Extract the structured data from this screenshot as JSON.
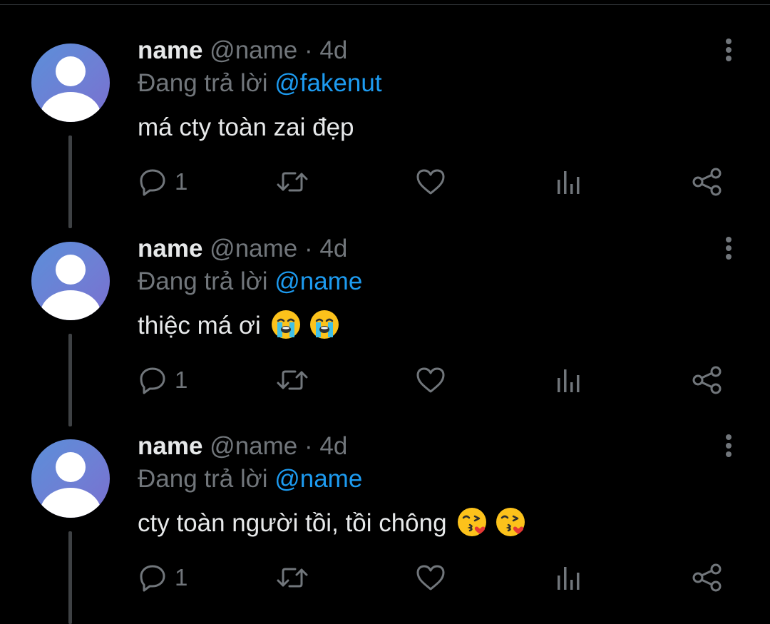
{
  "tweets": [
    {
      "name": "name",
      "handle": "@name",
      "separator": "·",
      "time": "4d",
      "reply_prefix": "Đang trả lời",
      "reply_to": "@fakenut",
      "text": "má cty toàn zai đẹp",
      "emojis": [],
      "reply_count": "1"
    },
    {
      "name": "name",
      "handle": "@name",
      "separator": "·",
      "time": "4d",
      "reply_prefix": "Đang trả lời",
      "reply_to": "@name",
      "text": "thiệc má ơi",
      "emojis": [
        "crying-face",
        "crying-face"
      ],
      "reply_count": "1"
    },
    {
      "name": "name",
      "handle": "@name",
      "separator": "·",
      "time": "4d",
      "reply_prefix": "Đang trả lời",
      "reply_to": "@name",
      "text": "cty toàn người tồi, tồi chông",
      "emojis": [
        "kissing-heart-face",
        "kissing-heart-face"
      ],
      "reply_count": "1"
    }
  ],
  "icons": {
    "reply": "reply-icon",
    "retweet": "retweet-icon",
    "like": "heart-icon",
    "views": "views-icon",
    "share": "share-icon",
    "more": "more-vertical-icon",
    "avatar": "default-avatar-icon"
  },
  "colors": {
    "background": "#000000",
    "primary_text": "#e7e9ea",
    "secondary_text": "#71767b",
    "link": "#1d9bf0",
    "thread_line": "#3e4144",
    "avatar_bg": "#6e7fd4"
  }
}
